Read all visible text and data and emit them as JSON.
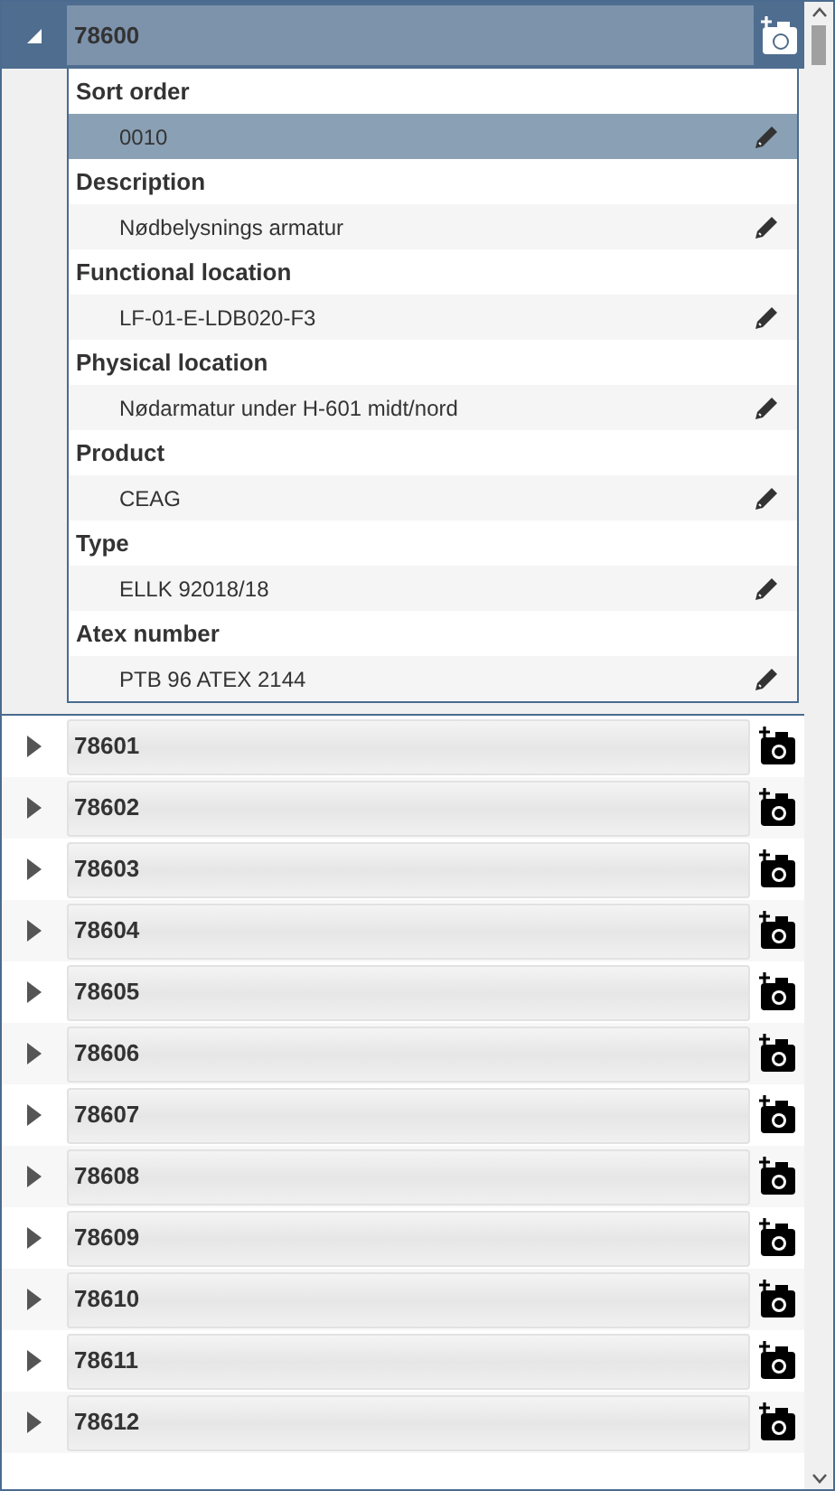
{
  "expanded_item": {
    "title": "78600",
    "expanded": true,
    "fields": [
      {
        "label": "Sort order",
        "value": "0010",
        "selected": true
      },
      {
        "label": "Description",
        "value": "Nødbelysnings armatur",
        "selected": false
      },
      {
        "label": "Functional location",
        "value": "LF-01-E-LDB020-F3",
        "selected": false
      },
      {
        "label": "Physical location",
        "value": "Nødarmatur under H-601 midt/nord",
        "selected": false
      },
      {
        "label": "Product",
        "value": "CEAG",
        "selected": false
      },
      {
        "label": "Type",
        "value": "ELLK 92018/18",
        "selected": false
      },
      {
        "label": "Atex number",
        "value": "PTB 96 ATEX 2144",
        "selected": false
      }
    ]
  },
  "items": [
    {
      "title": "78601",
      "expanded": false
    },
    {
      "title": "78602",
      "expanded": false
    },
    {
      "title": "78603",
      "expanded": false
    },
    {
      "title": "78604",
      "expanded": false
    },
    {
      "title": "78605",
      "expanded": false
    },
    {
      "title": "78606",
      "expanded": false
    },
    {
      "title": "78607",
      "expanded": false
    },
    {
      "title": "78608",
      "expanded": false
    },
    {
      "title": "78609",
      "expanded": false
    },
    {
      "title": "78610",
      "expanded": false
    },
    {
      "title": "78611",
      "expanded": false
    },
    {
      "title": "78612",
      "expanded": false
    }
  ]
}
